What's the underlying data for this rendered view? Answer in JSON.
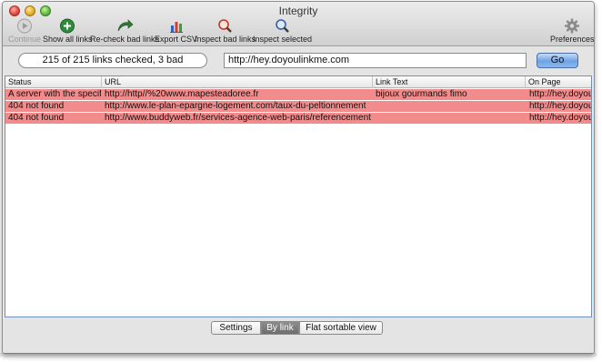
{
  "window": {
    "title": "Integrity"
  },
  "toolbar": {
    "items": [
      {
        "label": "Continue",
        "icon": "play-icon",
        "enabled": false
      },
      {
        "label": "Show all links",
        "icon": "add-circle-icon",
        "enabled": true
      },
      {
        "label": "Re-check bad links",
        "icon": "recheck-arrow-icon",
        "enabled": true
      },
      {
        "label": "Export CSV",
        "icon": "bar-chart-icon",
        "enabled": true
      },
      {
        "label": "Inspect bad links",
        "icon": "magnifier-red-icon",
        "enabled": true
      },
      {
        "label": "Inspect selected",
        "icon": "magnifier-blue-icon",
        "enabled": true
      },
      {
        "label": "Preferences",
        "icon": "gear-icon",
        "enabled": true
      }
    ]
  },
  "search": {
    "summary": "215 of 215 links checked, 3 bad",
    "url_value": "http://hey.doyoulinkme.com",
    "go_label": "Go"
  },
  "table": {
    "columns": [
      "Status",
      "URL",
      "Link Text",
      "On Page"
    ],
    "rows": [
      {
        "status": "A server with the specif",
        "url": "http://http//%20www.mapesteadoree.fr",
        "link_text": "bijoux gourmands fimo",
        "on_page": "http://hey.doyoulinkme.com"
      },
      {
        "status": "404 not found",
        "url": "http://www.le-plan-epargne-logement.com/taux-du-peltionnement",
        "link_text": "",
        "on_page": "http://hey.doyoulinkme.com"
      },
      {
        "status": "404 not found",
        "url": "http://www.buddyweb.fr/services-agence-web-paris/referencement",
        "link_text": "",
        "on_page": "http://hey.doyoulinkme.com"
      }
    ],
    "row_color": "#f28b8b"
  },
  "view_tabs": {
    "items": [
      "Settings",
      "By link",
      "Flat sortable view"
    ],
    "selected": "By link"
  }
}
